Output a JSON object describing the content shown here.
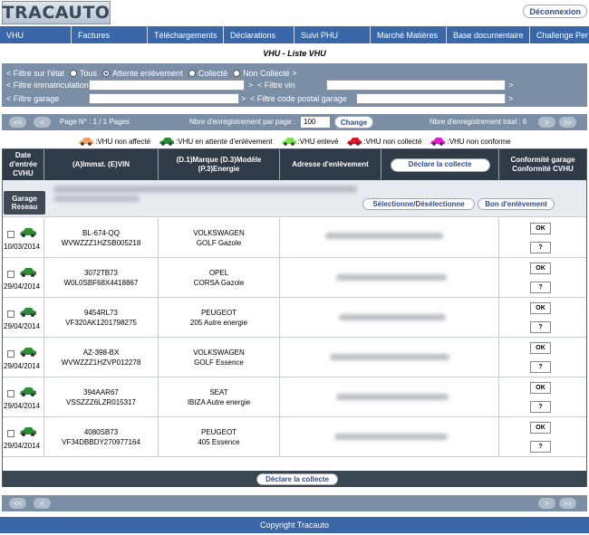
{
  "app": {
    "logo_text": "TRACAUTO",
    "logout_label": "Déconnexion"
  },
  "menu": {
    "items": [
      {
        "label": "VHU",
        "w": 79
      },
      {
        "label": "Factures",
        "w": 84
      },
      {
        "label": "Téléchargements",
        "w": 84
      },
      {
        "label": "Déclarations",
        "w": 78
      },
      {
        "label": "Suivi PHU",
        "w": 84
      },
      {
        "label": "Marché Matières",
        "w": 84
      },
      {
        "label": "Base documentaire",
        "w": 92
      },
      {
        "label": "Challenge Per",
        "w": 65
      }
    ]
  },
  "page_title": "VHU - Liste VHU",
  "filters": {
    "etat_label": "< Filtre sur l'état",
    "etat_options": [
      "Tous",
      "Attente enlèvement",
      "Collecté",
      "Non Collecté >"
    ],
    "etat_selected_index": 1,
    "immat_label": "< Filtre immatriculation",
    "vin_label": "< Filtre vin",
    "garage_label": "< Filtre garage",
    "cp_label": "< Filtre code postal garage",
    "arrow": ">"
  },
  "pager": {
    "first": "<<",
    "prev": "<",
    "next": ">",
    "last": ">>",
    "page_info": "Page N° : 1 / 1 Pages",
    "per_page_label": "Nbre d'enregistrement par page :",
    "per_page_value": "100",
    "change_label": "Change",
    "total_label": "Nbre d'enregistrement total : 6"
  },
  "legend": [
    {
      "label": ":VHU non affecté",
      "color": "#f0a060"
    },
    {
      "label": ":VHU en attente d'enlèvement",
      "color": "#2e8b3a"
    },
    {
      "label": ":VHU enlevé",
      "color": "#7be050"
    },
    {
      "label": ":VHU non collecté",
      "color": "#e0142e"
    },
    {
      "label": ":VHU non conforme",
      "color": "#e020d0"
    }
  ],
  "table": {
    "headers": {
      "date": "Date d'entrée CVHU",
      "immat": "(A)Immat. (E)VIN",
      "marque": "(D.1)Marque (D.3)Modèle (P.3)Energie",
      "adresse": "Adresse d'enlèvement",
      "declare": "Déclare la collecte",
      "conformite": "Conformité garage Conformité CVHU"
    },
    "garage_label": "Garage Reseau",
    "garage_text_1": "SPORT SA 7300 ... SEDEX ... 374",
    "garage_text_2": "Volkswagen Group France",
    "select_label": "Sélectionne/Désélectionne",
    "bon_label": "Bon d'enlèvement",
    "ok_label": "OK",
    "q_label": "?",
    "rows": [
      {
        "date": "10/03/2014",
        "immat": "BL-674-QQ",
        "vin": "WVWZZZ1HZSB005218",
        "marque": "VOLKSWAGEN",
        "modele": "GOLF Gazole"
      },
      {
        "date": "29/04/2014",
        "immat": "3072TB73",
        "vin": "W0L0SBF68X4418867",
        "marque": "OPEL",
        "modele": "CORSA Gazole"
      },
      {
        "date": "29/04/2014",
        "immat": "9454RL73",
        "vin": "VF320AK1201798275",
        "marque": "PEUGEOT",
        "modele": "205 Autre energie"
      },
      {
        "date": "29/04/2014",
        "immat": "AZ-398-BX",
        "vin": "WVWZZZ1HZVP012278",
        "marque": "VOLKSWAGEN",
        "modele": "GOLF Essence"
      },
      {
        "date": "29/04/2014",
        "immat": "394AAR67",
        "vin": "VSSZZZ6LZR015317",
        "marque": "SEAT",
        "modele": "IBIZA Autre energie"
      },
      {
        "date": "29/04/2014",
        "immat": "4080SB73",
        "vin": "VF34DBBDY270977164",
        "marque": "PEUGEOT",
        "modele": "405 Essence"
      }
    ],
    "footer_declare_label": "Déclare la collecte"
  },
  "footer": {
    "copyright": "Copyright Tracauto"
  }
}
